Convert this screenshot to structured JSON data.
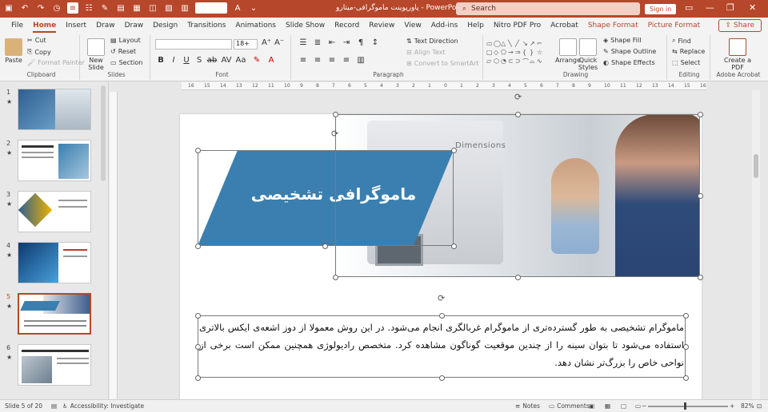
{
  "titlebar": {
    "doc_title": "پاورپوینت ماموگرافی-میتارو",
    "app_name": "PowerPoint",
    "search_placeholder": "Search",
    "signin_label": "Sign in",
    "brand_color": "#b7472a"
  },
  "tabs": [
    "File",
    "Home",
    "Insert",
    "Draw",
    "Draw",
    "Design",
    "Transitions",
    "Animations",
    "Slide Show",
    "Record",
    "Review",
    "View",
    "Add-ins",
    "Help",
    "Nitro PDF Pro",
    "Acrobat",
    "Shape Format",
    "Picture Format"
  ],
  "active_tab": "Home",
  "share_label": "Share",
  "ribbon": {
    "clipboard": {
      "label": "Clipboard",
      "paste": "Paste",
      "cut": "Cut",
      "copy": "Copy",
      "format_painter": "Format Painter"
    },
    "slides": {
      "label": "Slides",
      "new_slide": "New Slide",
      "layout": "Layout",
      "reset": "Reset",
      "section": "Section"
    },
    "font": {
      "label": "Font",
      "size": "18+"
    },
    "paragraph": {
      "label": "Paragraph",
      "text_direction": "Text Direction",
      "align_text": "Align Text",
      "convert_smartart": "Convert to SmartArt"
    },
    "drawing": {
      "label": "Drawing",
      "arrange": "Arrange",
      "quick_styles": "Quick Styles",
      "shape_fill": "Shape Fill",
      "shape_outline": "Shape Outline",
      "shape_effects": "Shape Effects"
    },
    "editing": {
      "label": "Editing",
      "find": "Find",
      "replace": "Replace",
      "select": "Select"
    },
    "acrobat": {
      "label": "Adobe Acrobat",
      "create_pdf": "Create a PDF"
    }
  },
  "thumbnails": [
    {
      "num": "1",
      "star": "★"
    },
    {
      "num": "2",
      "star": "★"
    },
    {
      "num": "3",
      "star": "★"
    },
    {
      "num": "4",
      "star": "★"
    },
    {
      "num": "5",
      "star": "★"
    },
    {
      "num": "6",
      "star": "★"
    }
  ],
  "selected_slide": "5",
  "ruler_ticks": [
    "16",
    "15",
    "14",
    "13",
    "12",
    "11",
    "10",
    "9",
    "8",
    "7",
    "6",
    "5",
    "4",
    "3",
    "2",
    "1",
    "0",
    "1",
    "2",
    "3",
    "4",
    "5",
    "6",
    "7",
    "8",
    "9",
    "10",
    "11",
    "12",
    "13",
    "14",
    "15",
    "16"
  ],
  "slide": {
    "title": "ماموگرافی تشخیصی",
    "brand_text": "Dimensions",
    "body": "ماموگرام تشخیصی به طور گسترده‌تری از ماموگرام غربالگری انجام می‌شود. در این روش معمولا از دوز اشعه‌ی ایکس بالاتری استفاده می‌شود تا بتوان سینه را از چندین موقعیت گوناگون مشاهده کرد. متخصص رادیولوژی همچنین ممکن است برخی از نواحی خاص را بزرگ‌تر نشان دهد.",
    "banner_color": "#3a7fb0"
  },
  "status": {
    "slide_info": "Slide 5 of 20",
    "accessibility": "Accessibility: Investigate",
    "notes": "Notes",
    "comments": "Comments",
    "zoom": "82%"
  }
}
